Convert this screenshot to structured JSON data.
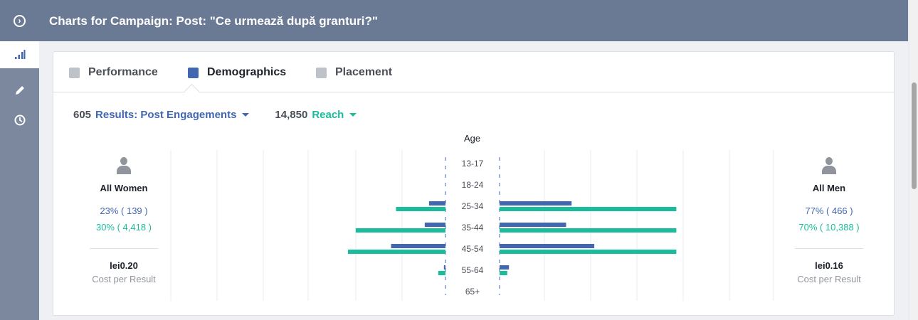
{
  "window": {
    "title": "Charts for Campaign: Post: \"Ce urmează după granturi?\""
  },
  "tabs": [
    {
      "label": "Performance",
      "active": false
    },
    {
      "label": "Demographics",
      "active": true
    },
    {
      "label": "Placement",
      "active": false
    }
  ],
  "metrics": {
    "results_count": "605",
    "results_label": "Results: Post Engagements",
    "reach_count": "14,850",
    "reach_label": "Reach"
  },
  "women": {
    "label": "All Women",
    "results_pct": "23% ( 139 )",
    "reach_pct": "30% ( 4,418 )",
    "cost": "lei0.20",
    "cost_label": "Cost per Result"
  },
  "men": {
    "label": "All Men",
    "results_pct": "77% ( 466 )",
    "reach_pct": "70% ( 10,388 )",
    "cost": "lei0.16",
    "cost_label": "Cost per Result"
  },
  "colors": {
    "results": "#4267b2",
    "reach": "#1bbc9b",
    "header": "#6b7a94"
  },
  "chart_data": {
    "type": "bar",
    "title": "Age",
    "categories": [
      "13-17",
      "18-24",
      "25-34",
      "35-44",
      "45-54",
      "55-64",
      "65+"
    ],
    "series": [
      {
        "name": "Results: Post Engagements",
        "group": "women",
        "values": [
          0,
          0,
          42,
          53,
          139,
          4,
          0
        ]
      },
      {
        "name": "Reach",
        "group": "women",
        "values": [
          0,
          0,
          1030,
          1870,
          2030,
          150,
          0
        ]
      },
      {
        "name": "Results: Post Engagements",
        "group": "men",
        "values": [
          0,
          0,
          184,
          170,
          242,
          24,
          0
        ]
      },
      {
        "name": "Reach",
        "group": "men",
        "values": [
          0,
          0,
          3680,
          3680,
          3680,
          160,
          0
        ]
      }
    ]
  }
}
